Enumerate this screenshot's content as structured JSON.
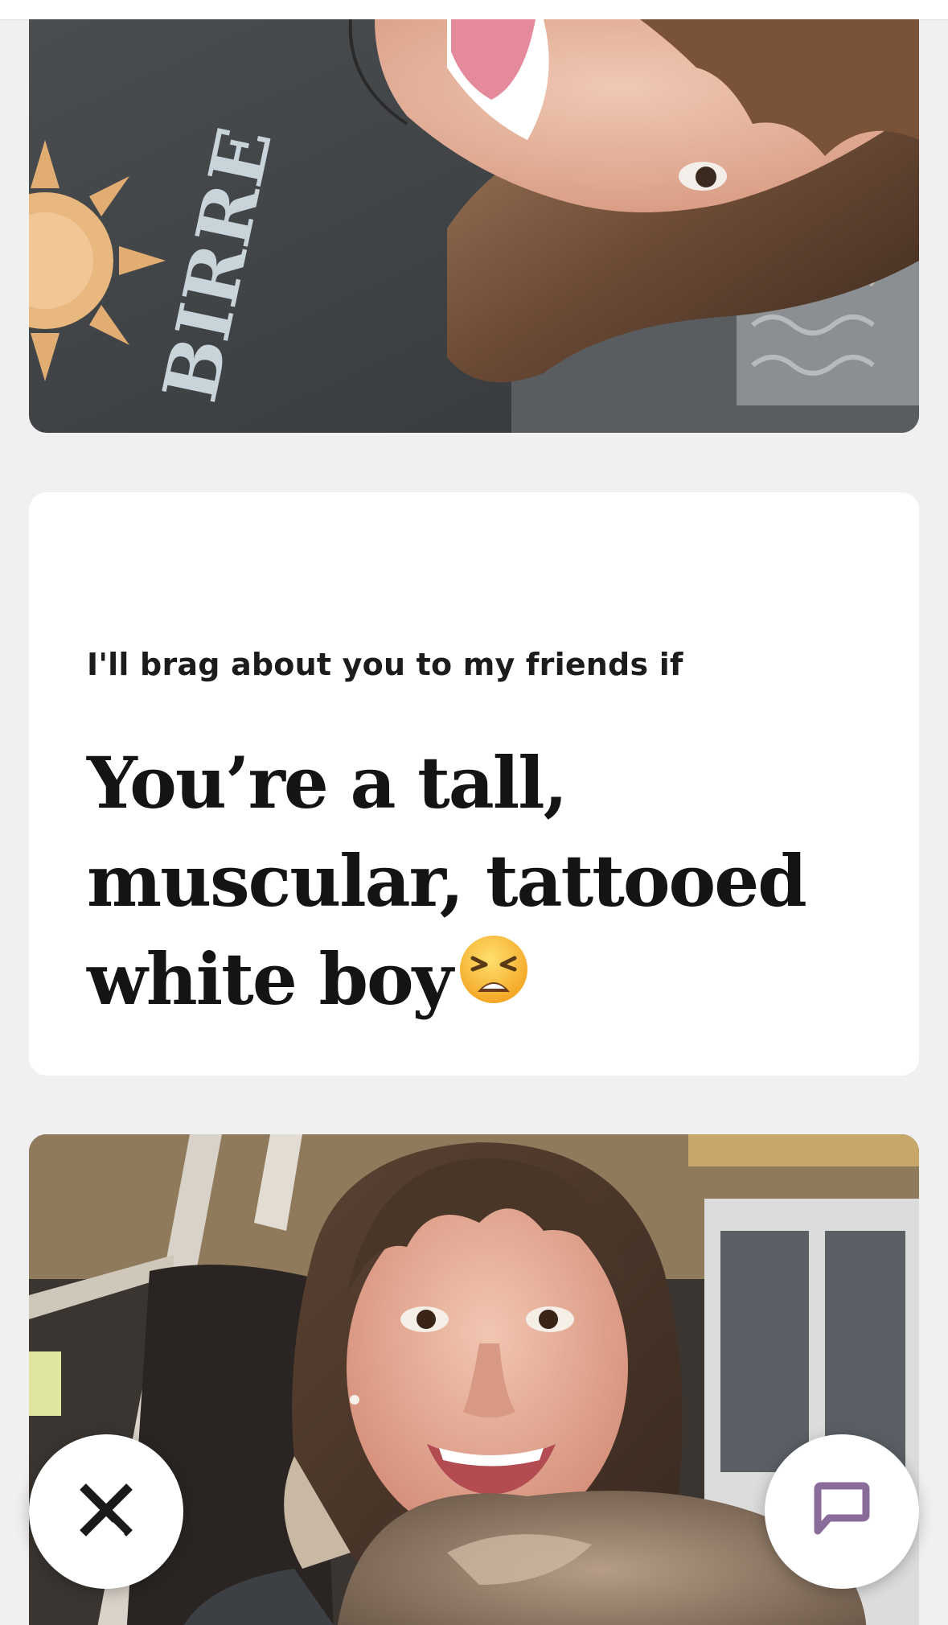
{
  "prompt": {
    "question": "I'll brag about you to my friends if",
    "answer": "You’re a tall, muscular, tattooed white boy",
    "emoji": "tired-face-emoji"
  },
  "photos": [
    {
      "name": "profile-photo-1",
      "description_icon": "photo"
    },
    {
      "name": "profile-photo-2",
      "description_icon": "photo"
    }
  ],
  "actions": {
    "skip_icon": "close-icon",
    "comment_icon": "chat-bubble-icon"
  },
  "colors": {
    "background": "#f0f0f0",
    "card": "#ffffff",
    "text": "#141414",
    "accent": "#8a6c9a"
  }
}
